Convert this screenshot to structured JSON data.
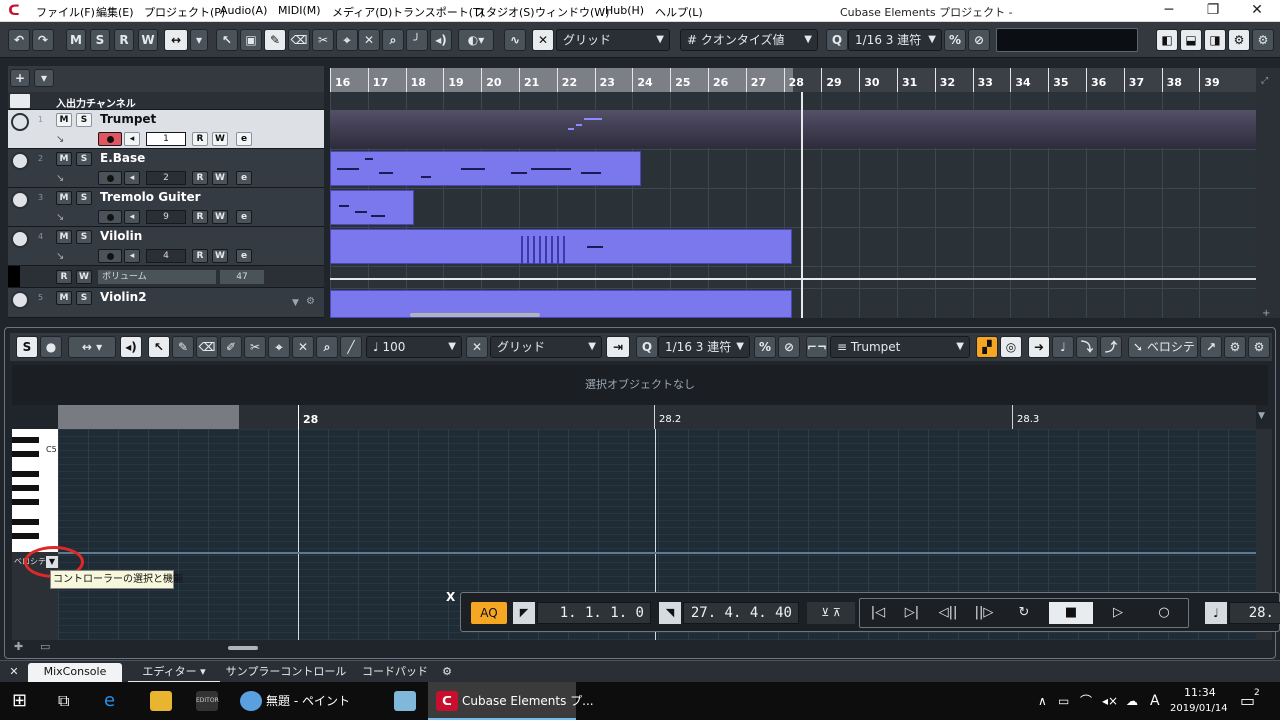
{
  "menu": {
    "items": [
      "ファイル(F)",
      "編集(E)",
      "プロジェクト(P)",
      "Audio(A)",
      "MIDI(M)",
      "メディア(D)",
      "トランスポート(T)",
      "スタジオ(S)",
      "ウィンドウ(W)",
      "Hub(H)",
      "ヘルプ(L)"
    ],
    "window_title": "Cubase Elements プロジェクト -",
    "min": "─",
    "restore": "❐",
    "close": "✕"
  },
  "toolbar1": {
    "undo": "↶",
    "redo": "↷",
    "m": "M",
    "s": "S",
    "r": "R",
    "w": "W",
    "snap_icon": "✕",
    "grid_label": "グリッド",
    "quantize_label": "クオンタイズ値",
    "quantize_hash": "#",
    "q_label": "Q",
    "quantize_value": "1/16 3 連符",
    "pct": "%"
  },
  "ruler1": {
    "bars": [
      "16",
      "17",
      "18",
      "19",
      "20",
      "21",
      "22",
      "23",
      "24",
      "25",
      "26",
      "27",
      "28",
      "29",
      "30",
      "31",
      "32",
      "33",
      "34",
      "35",
      "36",
      "37",
      "38",
      "39"
    ]
  },
  "tracklist": {
    "add": "+",
    "io_channel": "入出力チャンネル",
    "tracks": [
      {
        "num": "1",
        "name": "Trumpet",
        "ch": "1"
      },
      {
        "num": "2",
        "name": "E.Base",
        "ch": "2"
      },
      {
        "num": "3",
        "name": "Tremolo Guiter",
        "ch": "9"
      },
      {
        "num": "4",
        "name": "Vilolin",
        "ch": "4"
      },
      {
        "num": "5",
        "name": "Violin2",
        "ch": ""
      }
    ],
    "auto": {
      "label": "ボリューム",
      "value": "47"
    },
    "btn_m": "M",
    "btn_s": "S",
    "btn_r": "R",
    "btn_w": "W",
    "btn_e": "e"
  },
  "editor": {
    "velocity": "100",
    "grid_label": "グリッド",
    "q_label": "Q",
    "quantize_value": "1/16 3 連符",
    "pct": "%",
    "track_select": "Trumpet",
    "velocity_btn": "ベロシテ",
    "info": "選択オブジェクトなし",
    "ruler": [
      "28",
      "28.2",
      "28.3"
    ],
    "c5": "C5",
    "ctrl_lane": "ベロシテ",
    "tooltip": "コントローラーの選択と機能"
  },
  "transport": {
    "close": "X",
    "aq": "AQ",
    "left_locator": "1. 1. 1.  0",
    "right_locator": "27. 4. 4. 40",
    "right_value": "28."
  },
  "tabs": {
    "close": "✕",
    "items": [
      "MixConsole",
      "エディター",
      "サンプラーコントロール",
      "コードパッド"
    ]
  },
  "taskbar": {
    "paint": "無題 - ペイント",
    "cubase": "Cubase Elements プ...",
    "editor_tag": "EDITOR",
    "time": "11:34",
    "date": "2019/01/14",
    "ime": "A",
    "notif": "2"
  },
  "colors": {
    "part": "#7b78ee",
    "accent": "#f5a623",
    "record": "#e05560",
    "selected_track": "#dde1e6"
  }
}
